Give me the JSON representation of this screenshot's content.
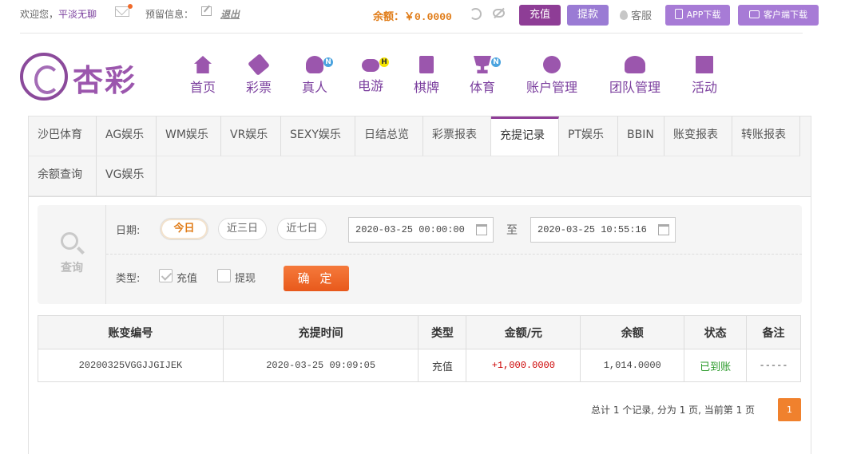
{
  "topbar": {
    "welcome": "欢迎您，",
    "username": "平淡无聊",
    "reserve_label": "预留信息：",
    "logout": "退出",
    "balance": "余额：￥0.0000",
    "deposit": "充值",
    "withdraw": "提款",
    "service": "客服",
    "app_download": "APP下载",
    "client_download": "客户端下载"
  },
  "brand": "杏彩",
  "nav": [
    {
      "label": "首页",
      "icon": "home-icon"
    },
    {
      "label": "彩票",
      "icon": "ticket-icon"
    },
    {
      "label": "真人",
      "icon": "dealer-icon",
      "badge": "N"
    },
    {
      "label": "电游",
      "icon": "gamepad-icon",
      "badge": "H"
    },
    {
      "label": "棋牌",
      "icon": "cards-icon"
    },
    {
      "label": "体育",
      "icon": "trophy-icon",
      "badge": "N"
    },
    {
      "label": "账户管理",
      "icon": "account-icon"
    },
    {
      "label": "团队管理",
      "icon": "team-icon"
    },
    {
      "label": "活动",
      "icon": "gift-icon"
    }
  ],
  "tabs": [
    "沙巴体育",
    "AG娱乐",
    "WM娱乐",
    "VR娱乐",
    "SEXY娱乐",
    "日结总览",
    "彩票报表",
    "充提记录",
    "PT娱乐",
    "BBIN",
    "账变报表",
    "转账报表",
    "余额查询",
    "VG娱乐"
  ],
  "active_tab": "充提记录",
  "filter": {
    "query_label": "查询",
    "date_label": "日期:",
    "ranges": [
      "今日",
      "近三日",
      "近七日"
    ],
    "start": "2020-03-25 00:00:00",
    "to": "至",
    "end": "2020-03-25 10:55:16",
    "type_label": "类型:",
    "type_deposit": "充值",
    "type_withdraw": "提现",
    "confirm": "确 定"
  },
  "table": {
    "headers": [
      "账变编号",
      "充提时间",
      "类型",
      "金额/元",
      "余额",
      "状态",
      "备注"
    ],
    "rows": [
      [
        "20200325VGGJJGIJEK",
        "2020-03-25 09:09:05",
        "充值",
        "+1,000.0000",
        "1,014.0000",
        "已到账",
        "-----"
      ]
    ]
  },
  "pager": {
    "info": "总计 1 个记录, 分为 1 页, 当前第 1 页",
    "page": "1"
  },
  "colors": {
    "primary": "#8e3d96",
    "accent": "#f0812d",
    "balance": "#e07b16",
    "success": "#2b9b2b"
  }
}
